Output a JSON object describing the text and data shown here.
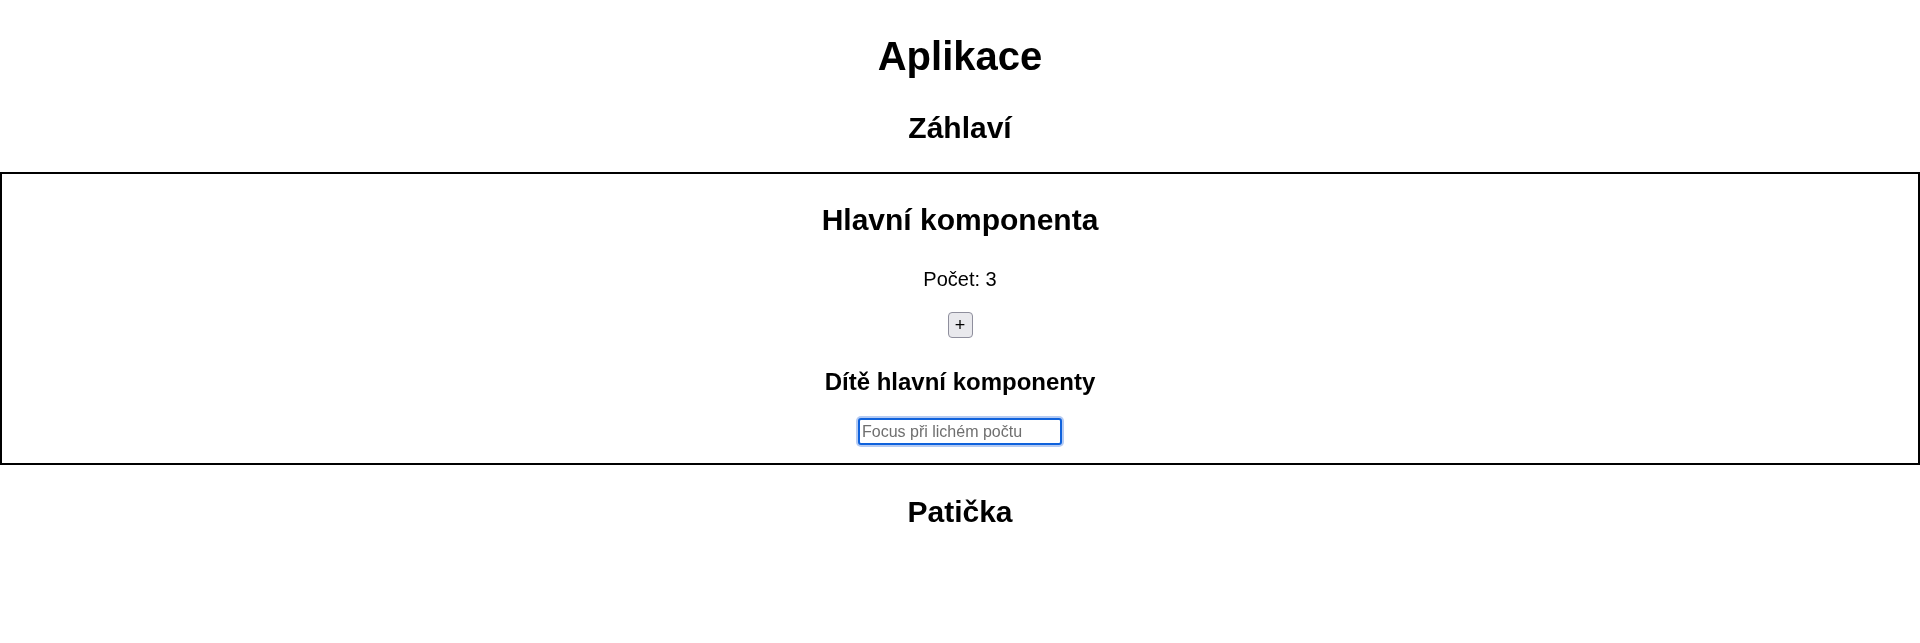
{
  "app": {
    "title": "Aplikace"
  },
  "header": {
    "title": "Záhlaví"
  },
  "main_component": {
    "title": "Hlavní komponenta",
    "count_label": "Počet: 3",
    "increment_button": "+",
    "child": {
      "title": "Dítě hlavní komponenty",
      "input": {
        "placeholder": "Focus při lichém počtu",
        "focused": true
      }
    }
  },
  "footer": {
    "title": "Patička"
  }
}
